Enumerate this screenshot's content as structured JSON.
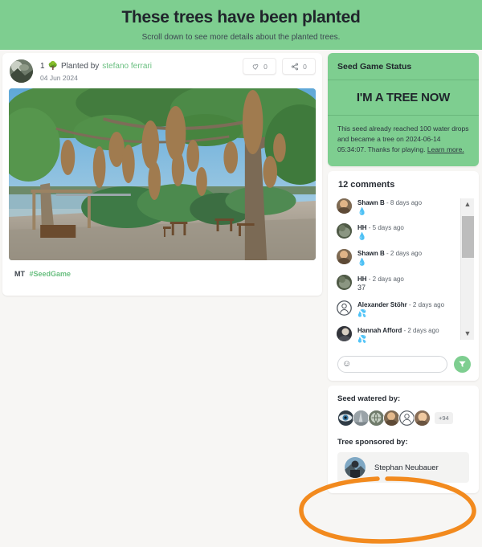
{
  "banner": {
    "title": "These trees have been planted",
    "subtitle": "Scroll down to see more details about the planted trees.",
    "bg_color": "#7ece90"
  },
  "post": {
    "tree_count": "1",
    "tree_icon": "tree-icon",
    "planted_by_label": "Planted by",
    "planter_name": "stefano ferrari",
    "date": "04 Jun 2024",
    "like_count": "0",
    "share_count": "0",
    "like_icon": "heart-icon",
    "share_icon": "share-icon",
    "tag_prefix": "MT",
    "tag_link": "#SeedGame",
    "photo_alt": "riverside tree with hanging weaver bird nests"
  },
  "seed_status": {
    "title": "Seed Game Status",
    "banner_text": "I'M A TREE NOW",
    "description_before": "This seed already reached 100 water drops and became a tree on 2024-06-14 05:34:07. Thanks for playing.",
    "learn_more": "Learn more.",
    "bg_color": "#7ece90"
  },
  "comments": {
    "heading": "12 comments",
    "items": [
      {
        "author": "Shawn B",
        "time": "- 8 days ago",
        "body": "💧",
        "avatar": "avatar-shawn"
      },
      {
        "author": "HH",
        "time": "- 5 days ago",
        "body": "💧",
        "avatar": "avatar-hh"
      },
      {
        "author": "Shawn B",
        "time": "- 2 days ago",
        "body": "💧",
        "avatar": "avatar-shawn"
      },
      {
        "author": "HH",
        "time": "- 2 days ago",
        "body": "37",
        "avatar": "avatar-hh"
      },
      {
        "author": "Alexander Stöhr",
        "time": "- 2 days ago",
        "body": "💦",
        "avatar": "avatar-placeholder"
      },
      {
        "author": "Hannah Afford",
        "time": "- 2 days ago",
        "body": "💦",
        "avatar": "avatar-hannah"
      }
    ],
    "input_placeholder": "",
    "input_value": "",
    "emoji_icon": "emoji-face-icon",
    "send_icon": "send-icon",
    "scroll_up_icon": "▲",
    "scroll_down_icon": "▼"
  },
  "watered": {
    "title": "Seed watered by:",
    "overflow_count": "+94",
    "avatars": [
      "avatar-eye",
      "avatar-tower",
      "avatar-globe",
      "avatar-person1",
      "avatar-placeholder",
      "avatar-person2"
    ]
  },
  "sponsor": {
    "title": "Tree sponsored by:",
    "name": "Stephan Neubauer",
    "avatar": "avatar-stephan"
  },
  "annotation": {
    "shape": "ellipse-highlight",
    "color": "#f28a1e"
  }
}
